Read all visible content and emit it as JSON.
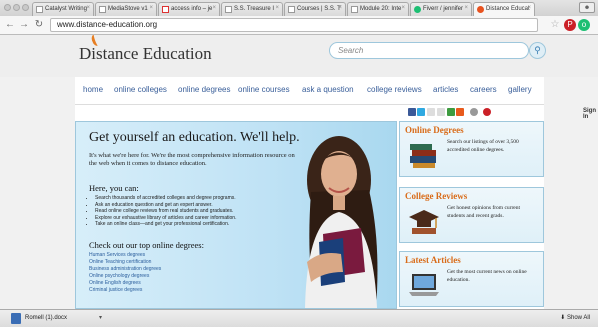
{
  "browser": {
    "tabs": [
      {
        "label": "Catalyst Writing",
        "active": false
      },
      {
        "label": "MediaStove v1",
        "active": false
      },
      {
        "label": "access info – je",
        "active": false
      },
      {
        "label": "S.S. Treasure I",
        "active": false
      },
      {
        "label": "Courses | S.S. T",
        "active": false
      },
      {
        "label": "Module 20: Inte",
        "active": false
      },
      {
        "label": "Fiverr / jennifer",
        "active": false
      },
      {
        "label": "Distance Educat",
        "active": true
      }
    ],
    "url": "www.distance-education.org"
  },
  "site": {
    "logo": "Distance Education",
    "search_placeholder": "Search",
    "nav": [
      "home",
      "online colleges",
      "online degrees",
      "online courses",
      "ask a question",
      "college reviews",
      "articles",
      "careers",
      "gallery"
    ],
    "signin": "Sign In",
    "hero": {
      "title": "Get yourself an education. We'll help.",
      "intro": "It's what we're here for. We're the most comprehensive information resource on the web when it comes to distance education.",
      "here_heading": "Here, you can:",
      "bullets": [
        "Search thousands of accredited colleges and degree programs.",
        "Ask an education question and get an expert answer.",
        "Read online college reviews from real students and graduates.",
        "Explore our exhaustive library of articles and career information.",
        "Take an online class—and get your professional certification."
      ],
      "degrees_heading": "Check out our top online degrees:",
      "degrees": [
        "Human Services degrees",
        "Online Teaching certification",
        "Business administration degrees",
        "Online psychology degrees",
        "Online English degrees",
        "Criminal justice degrees"
      ]
    },
    "sidebar": [
      {
        "title": "Online Degrees",
        "text": "Search our listings of over 3,500 accredited online degrees."
      },
      {
        "title": "College Reviews",
        "text": "Get honest opinions from current students and recent grads."
      },
      {
        "title": "Latest Articles",
        "text": "Get the most current news on online education."
      }
    ]
  },
  "downloads": {
    "file": "Romell (1).docx",
    "show_all": "Show All"
  },
  "colors": {
    "accent_orange": "#d96c1a",
    "link_blue": "#3a5f9a",
    "hero_blue": "#bfe2f5"
  }
}
